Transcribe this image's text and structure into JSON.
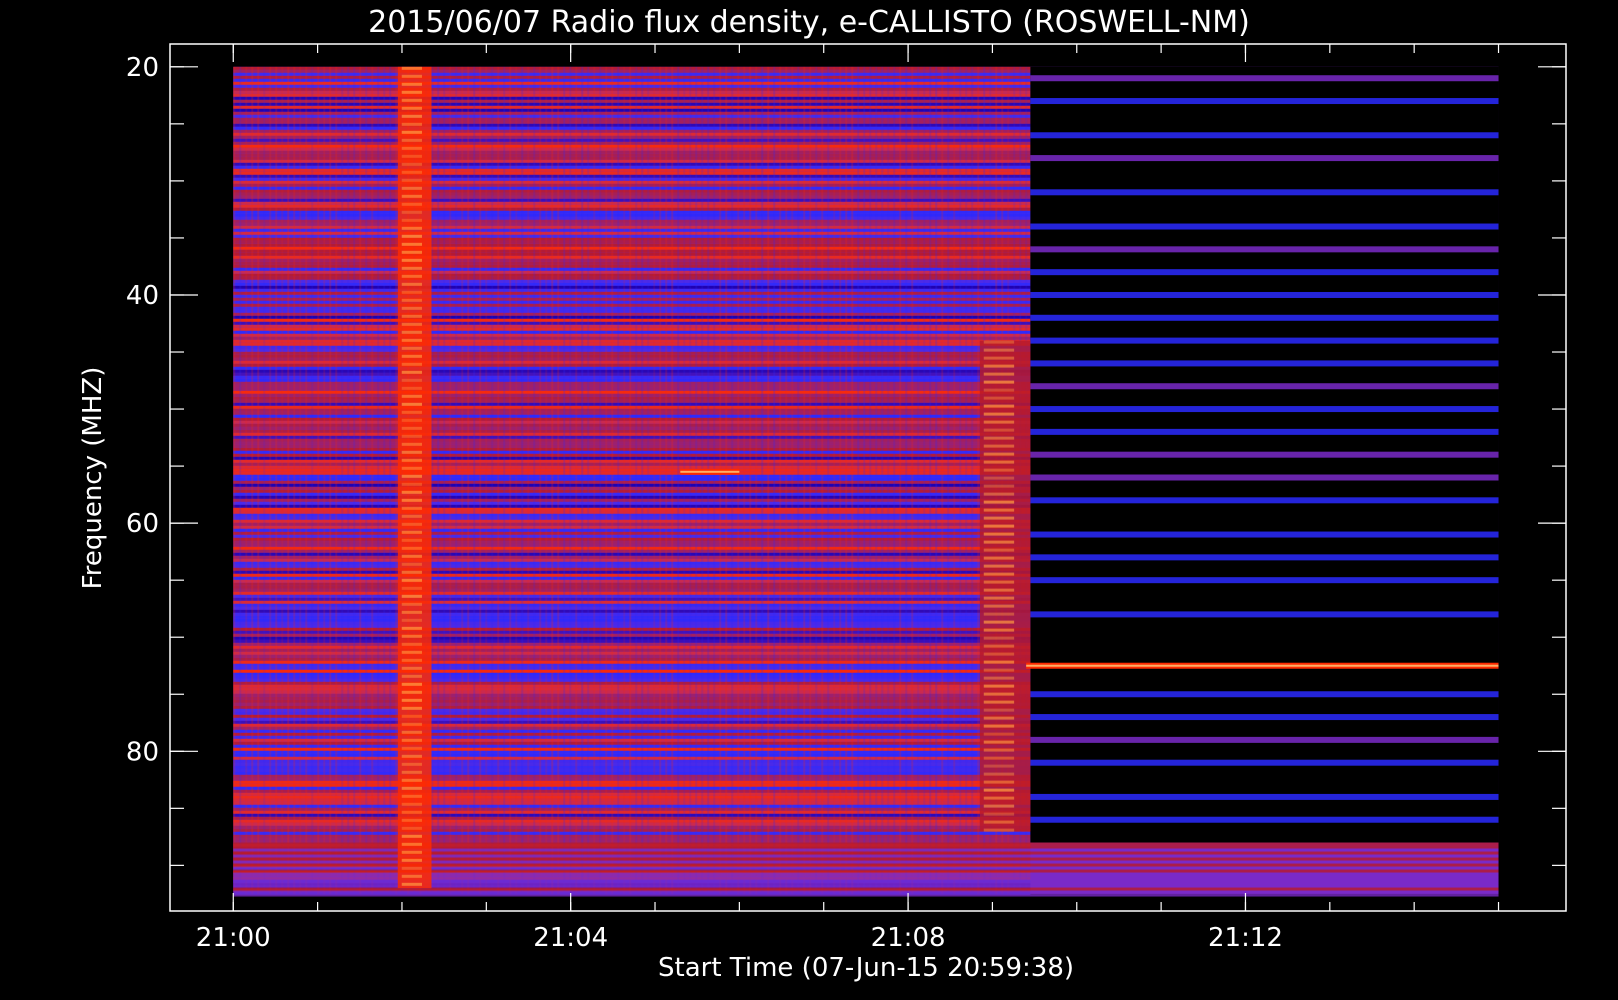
{
  "chart_data": {
    "type": "heatmap",
    "title": "2015/06/07  Radio flux density, e-CALLISTO (ROSWELL-NM)",
    "xlabel": "Start Time (07-Jun-15 20:59:38)",
    "ylabel": "Frequency (MHZ)",
    "x_ticks": [
      "21:00",
      "21:04",
      "21:08",
      "21:12"
    ],
    "x_tick_minutes": [
      0,
      4,
      8,
      12
    ],
    "x_minor_step_minutes": 1,
    "xlim_minutes": [
      -0.75,
      15.8
    ],
    "y_ticks": [
      "20",
      "40",
      "60",
      "80"
    ],
    "y_tick_values": [
      20,
      40,
      60,
      80
    ],
    "y_minor_step": 5,
    "ylim": [
      18,
      94
    ],
    "y_inverted": true,
    "data_extent": {
      "time_minutes": [
        0,
        15
      ],
      "frequency_mhz": [
        20,
        92.5
      ]
    },
    "colormap": [
      "#000000",
      "#1a00b0",
      "#2a2aff",
      "#7a2ac8",
      "#b81a2a",
      "#ff2a00",
      "#ff9a40",
      "#ffe890"
    ],
    "features": [
      {
        "label": "broadband burst",
        "time_minutes": [
          1.95,
          2.35
        ],
        "frequency_mhz": [
          20,
          92
        ]
      },
      {
        "label": "interference block",
        "time_minutes": [
          8.85,
          9.45
        ],
        "frequency_mhz": [
          44,
          87
        ]
      },
      {
        "label": "narrowband emission",
        "time_minutes": [
          5.3,
          6.0
        ],
        "frequency_mhz": [
          55.5
        ]
      },
      {
        "label": "steady narrowband line",
        "time_minutes": [
          9.4,
          15
        ],
        "frequency_mhz": [
          72.5
        ]
      }
    ]
  }
}
